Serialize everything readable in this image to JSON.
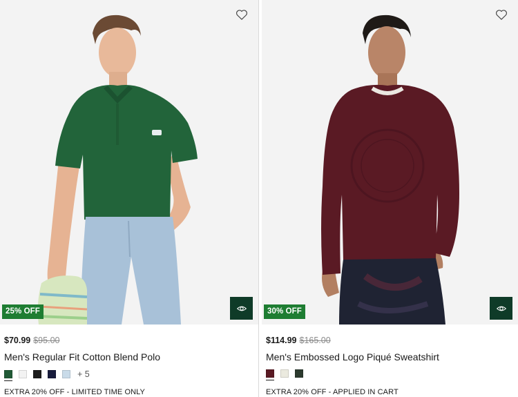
{
  "colors": {
    "badge_green": "#1e7d32",
    "quickview_green": "#0f3b28",
    "image_background": "#f3f3f3"
  },
  "products": [
    {
      "image_alt": "Model wearing green polo",
      "discount_badge": "25% OFF",
      "price_current": "$70.99",
      "price_original": "$95.00",
      "name": "Men's Regular Fit Cotton Blend Polo",
      "swatches": [
        {
          "color": "#215a36",
          "selected": true
        },
        {
          "color": "#f2f2f2",
          "selected": false
        },
        {
          "color": "#1c1c1c",
          "selected": false
        },
        {
          "color": "#181c3c",
          "selected": false
        },
        {
          "color": "#c9dbe9",
          "selected": false
        }
      ],
      "more_colors": "+ 5",
      "promo": "EXTRA 20% OFF - LIMITED TIME ONLY",
      "wishlist_icon": "heart-outline-icon",
      "quickview_icon": "eye-icon"
    },
    {
      "image_alt": "Model wearing burgundy sweatshirt",
      "discount_badge": "30% OFF",
      "price_current": "$114.99",
      "price_original": "$165.00",
      "name": "Men's Embossed Logo Piqué Sweatshirt",
      "swatches": [
        {
          "color": "#5a1a24",
          "selected": true
        },
        {
          "color": "#ebeadf",
          "selected": false
        },
        {
          "color": "#2c3a2e",
          "selected": false
        }
      ],
      "more_colors": "",
      "promo": "EXTRA 20% OFF - APPLIED IN CART",
      "wishlist_icon": "heart-outline-icon",
      "quickview_icon": "eye-icon"
    }
  ]
}
